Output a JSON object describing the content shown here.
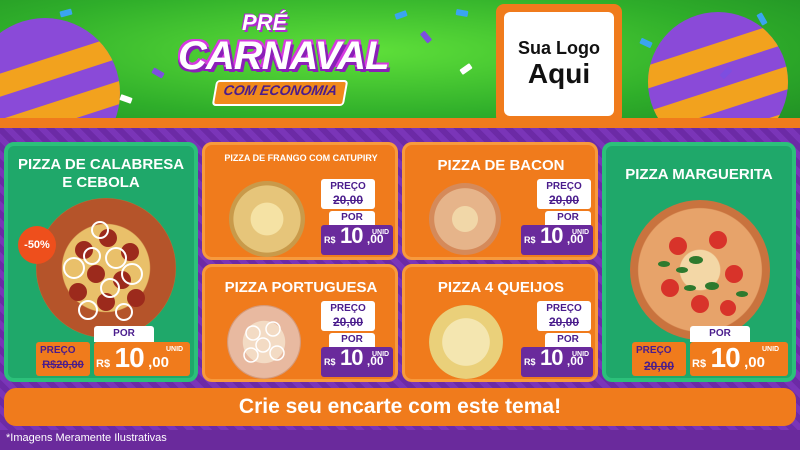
{
  "header": {
    "badge_pre": "PRÉ",
    "badge_word": "CARNAVAL",
    "badge_sub": "COM ECONOMIA",
    "logo_line1": "Sua Logo",
    "logo_line2": "Aqui"
  },
  "products": [
    {
      "name": "PIZZA DE CALABRESA E CEBOLA",
      "discount": "-50%",
      "price_label": "PREÇO",
      "old_price": "R$20,00",
      "por_label": "POR",
      "currency": "R$",
      "price_int": "10",
      "price_dec": ",00",
      "unit": "UNID"
    },
    {
      "name": "PIZZA DE FRANGO COM CATUPIRY",
      "price_label": "PREÇO",
      "old_price": "20,00",
      "por_label": "POR",
      "currency": "R$",
      "price_int": "10",
      "price_dec": ",00",
      "unit": "UNID"
    },
    {
      "name": "PIZZA DE BACON",
      "price_label": "PREÇO",
      "old_price": "20,00",
      "por_label": "POR",
      "currency": "R$",
      "price_int": "10",
      "price_dec": ",00",
      "unit": "UNID"
    },
    {
      "name": "PIZZA PORTUGUESA",
      "price_label": "PREÇO",
      "old_price": "20,00",
      "por_label": "POR",
      "currency": "R$",
      "price_int": "10",
      "price_dec": ",00",
      "unit": "UNID"
    },
    {
      "name": "PIZZA 4 QUEIJOS",
      "price_label": "PREÇO",
      "old_price": "20,00",
      "por_label": "POR",
      "currency": "R$",
      "price_int": "10",
      "price_dec": ",00",
      "unit": "UNID"
    },
    {
      "name": "PIZZA MARGUERITA",
      "price_label": "PREÇO",
      "old_price": "20,00",
      "por_label": "POR",
      "currency": "R$",
      "price_int": "10",
      "price_dec": ",00",
      "unit": "UNID"
    }
  ],
  "cta": "Crie seu encarte com este tema!",
  "footnote": "*Imagens Meramente Ilustrativas",
  "colors": {
    "purple": "#6a2a9c",
    "orange": "#f07b1c",
    "green": "#1fa86a",
    "dark_purple": "#4a1c8c",
    "red_badge": "#ee4f1c"
  },
  "icons": [
    "easter-egg-icon",
    "confetti-icon",
    "pizza-calabresa-image",
    "pizza-frango-image",
    "pizza-bacon-image",
    "pizza-portuguesa-image",
    "pizza-quatro-queijos-image",
    "pizza-marguerita-image"
  ]
}
